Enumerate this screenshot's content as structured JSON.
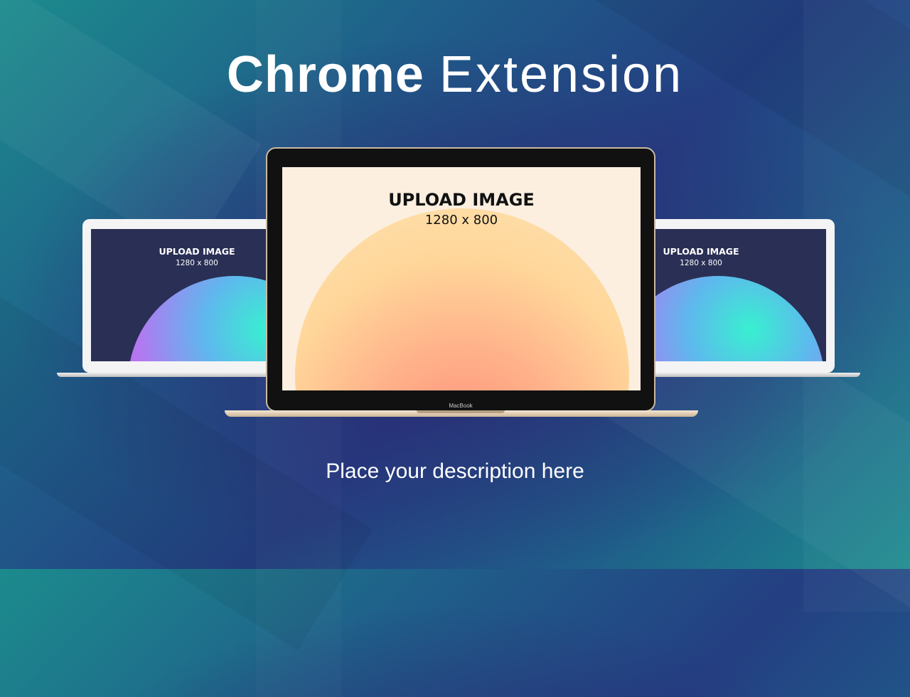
{
  "header": {
    "title_bold": "Chrome",
    "title_light": "Extension"
  },
  "laptops": {
    "left": {
      "label": "UPLOAD IMAGE",
      "size": "1280 x 800"
    },
    "center": {
      "label": "UPLOAD IMAGE",
      "size": "1280 x 800",
      "brand": "MacBook"
    },
    "right": {
      "label": "UPLOAD IMAGE",
      "size": "1280 x 800"
    }
  },
  "footer": {
    "description": "Place your description here"
  },
  "colors": {
    "background_primary": "#243f82",
    "background_secondary": "#1c8b8d",
    "center_screen": "#fcefe0",
    "side_screen": "#2a2f55"
  }
}
